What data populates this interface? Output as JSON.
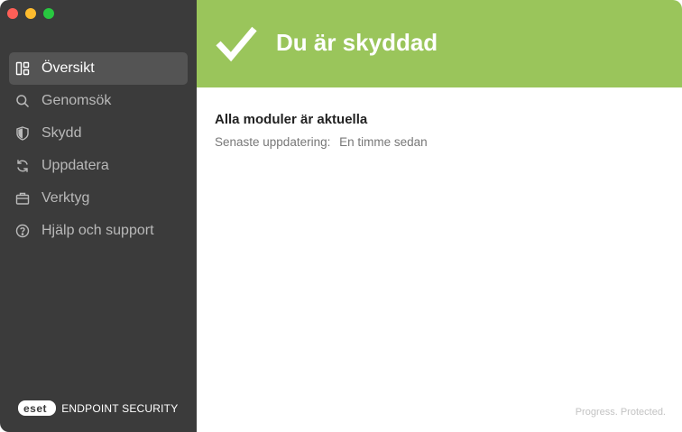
{
  "window": {
    "controls": [
      "close",
      "minimize",
      "maximize"
    ]
  },
  "sidebar": {
    "items": [
      {
        "label": "Översikt",
        "icon": "overview-icon",
        "active": true
      },
      {
        "label": "Genomsök",
        "icon": "search-icon",
        "active": false
      },
      {
        "label": "Skydd",
        "icon": "shield-icon",
        "active": false
      },
      {
        "label": "Uppdatera",
        "icon": "refresh-icon",
        "active": false
      },
      {
        "label": "Verktyg",
        "icon": "toolbox-icon",
        "active": false
      },
      {
        "label": "Hjälp och support",
        "icon": "help-icon",
        "active": false
      }
    ],
    "brand": {
      "logo": "eset",
      "product": "ENDPOINT SECURITY"
    }
  },
  "banner": {
    "title": "Du är skyddad",
    "icon": "checkmark-icon",
    "color": "#9ac55b"
  },
  "status": {
    "title": "Alla moduler är aktuella",
    "last_update_label": "Senaste uppdatering:",
    "last_update_value": "En timme sedan"
  },
  "footer": {
    "tagline": "Progress. Protected."
  }
}
